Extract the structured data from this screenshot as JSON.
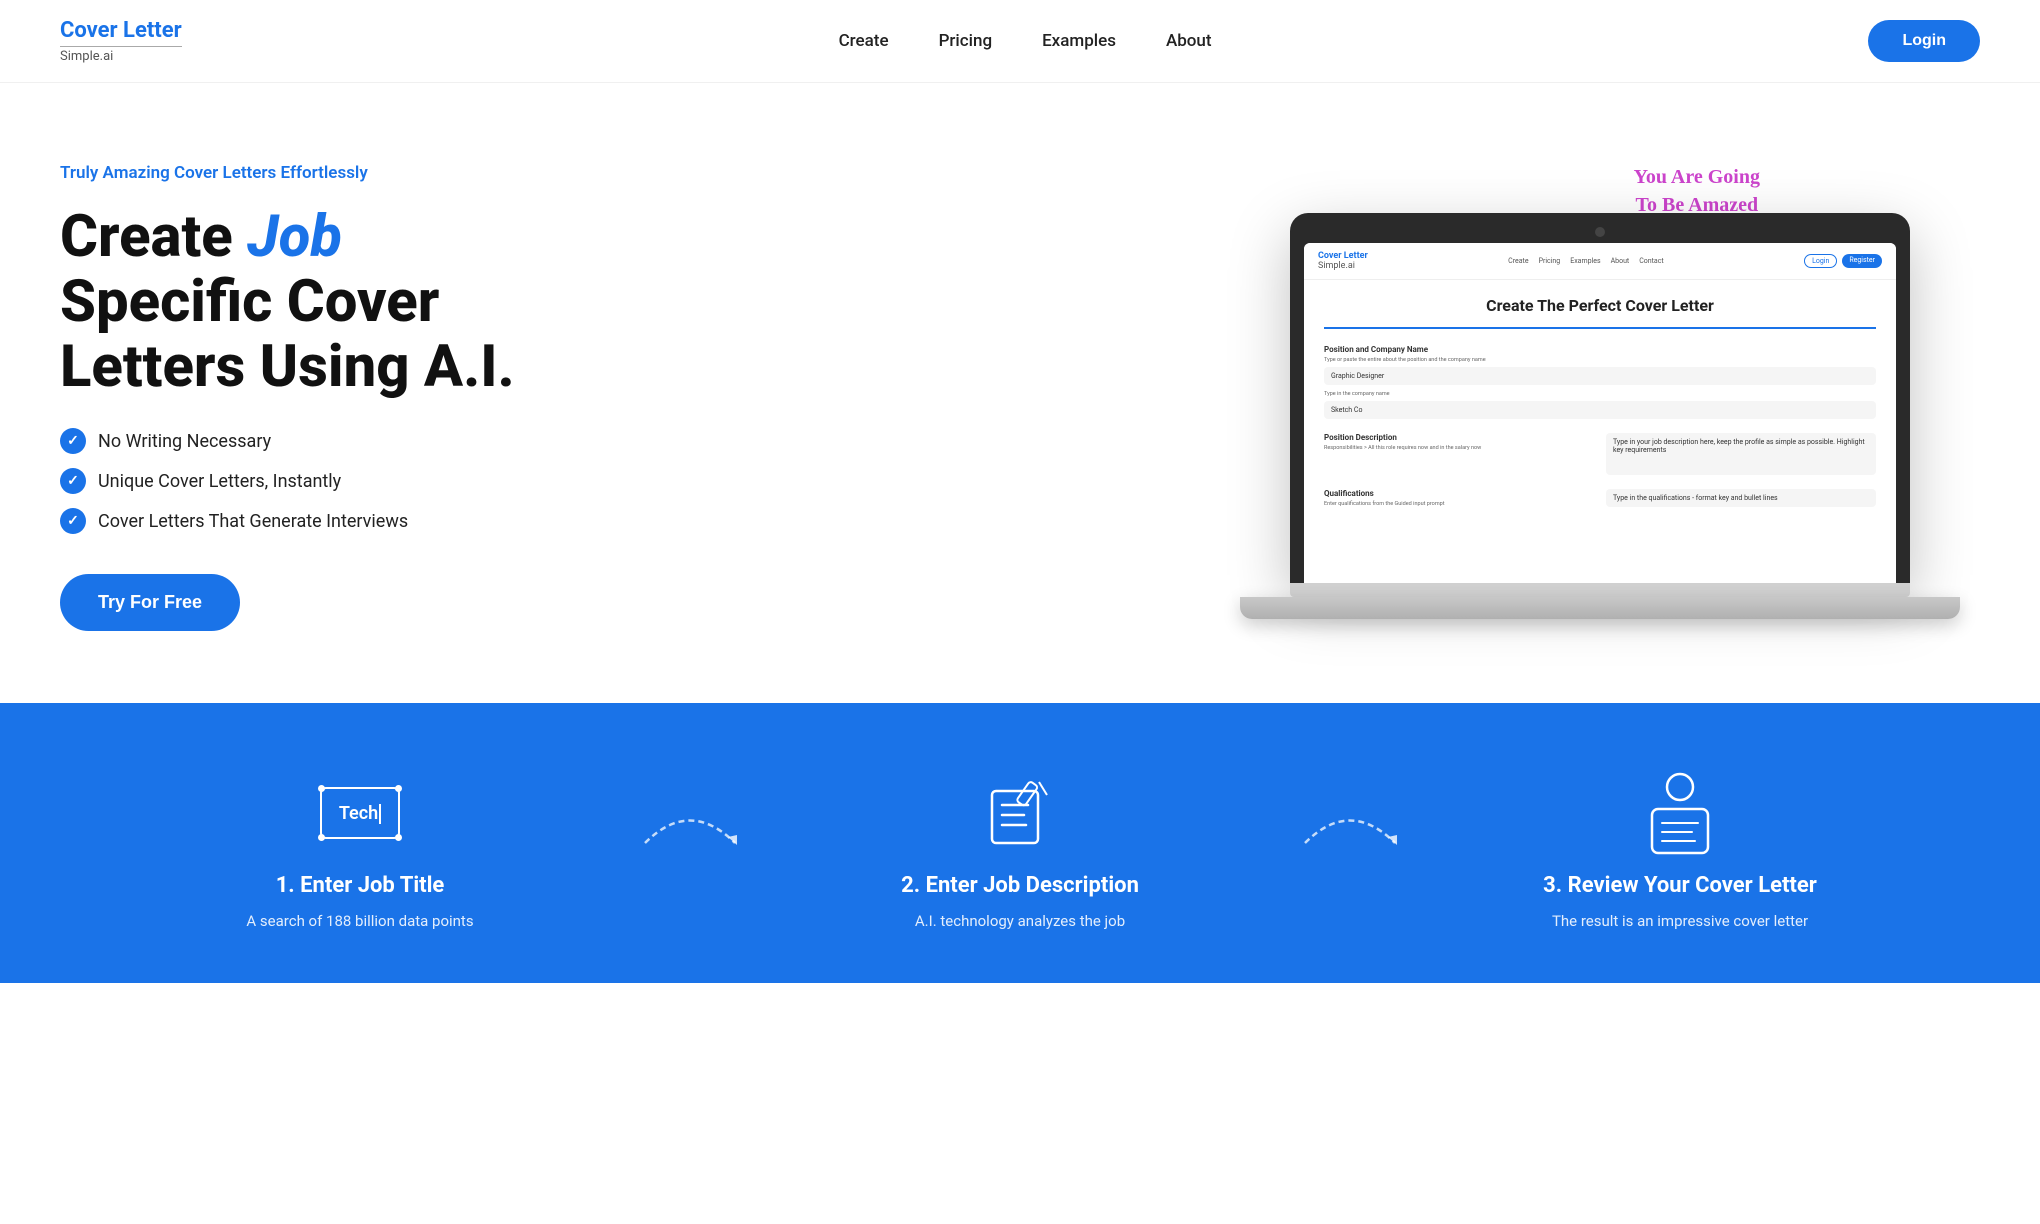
{
  "brand": {
    "name": "Cover Letter",
    "subtitle": "Simple.ai"
  },
  "nav": {
    "links": [
      {
        "label": "Create",
        "href": "#"
      },
      {
        "label": "Pricing",
        "href": "#"
      },
      {
        "label": "Examples",
        "href": "#"
      },
      {
        "label": "About",
        "href": "#"
      }
    ],
    "login_label": "Login"
  },
  "hero": {
    "tagline": "Truly Amazing Cover Letters Effortlessly",
    "headline_part1": "Create ",
    "headline_highlight": "Job",
    "headline_part2": "Specific Cover Letters Using A.I.",
    "bullets": [
      "No Writing Necessary",
      "Unique Cover Letters, Instantly",
      "Cover Letters That Generate Interviews"
    ],
    "cta_label": "Try For Free",
    "annotation": "You Are Going\nTo Be Amazed"
  },
  "laptop_screen": {
    "title": "Create The Perfect Cover Letter",
    "nav_links": [
      "Create",
      "Pricing",
      "Examples",
      "About",
      "Contact"
    ],
    "login": "Login",
    "register": "Register",
    "fields": {
      "position_label": "Position and Company Name",
      "position_sub": "Type or paste the entire about the position and the company name",
      "position_value": "Graphic Designer",
      "company_sub": "Type in the company name",
      "company_value": "Sketch Co",
      "description_label": "Position Description",
      "description_sub": "Responsibilities > All this role requires now and in the salary now",
      "description_placeholder": "Type in your job description here, keep the profile as simple as possible. Highlight key requirements",
      "qualifications_label": "Qualifications",
      "qualifications_sub": "Enter qualifications from the Guided input prompt",
      "qualifications_placeholder": "Type in the qualifications - format key and bullet lines"
    }
  },
  "steps": [
    {
      "number": "1.",
      "title": "Enter Job Title",
      "description": "A search of 188 billion data points",
      "icon_type": "textbox",
      "icon_text": "Tech"
    },
    {
      "number": "2.",
      "title": "Enter Job Description",
      "description": "A.I. technology analyzes the job",
      "icon_type": "doc-pen"
    },
    {
      "number": "3.",
      "title": "Review Your Cover Letter",
      "description": "The result is an impressive cover letter",
      "icon_type": "person-doc"
    }
  ],
  "colors": {
    "primary": "#1a73e8",
    "annotation": "#cc44cc",
    "text_dark": "#111",
    "text_medium": "#555"
  }
}
